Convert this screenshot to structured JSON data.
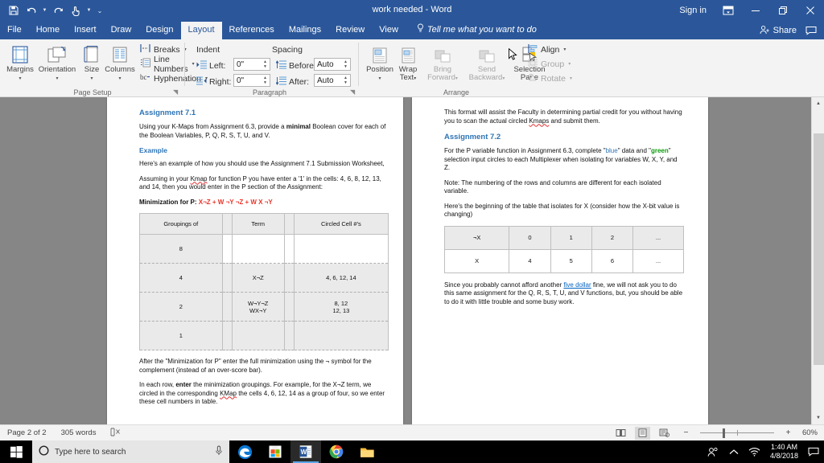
{
  "window": {
    "title": "work needed  -  Word",
    "sign_in": "Sign in",
    "ribbon_display_icon": "ribbon-display-options-icon",
    "minimize_icon": "minimize-icon",
    "restore_icon": "restore-icon",
    "close_icon": "close-icon",
    "quick_access": [
      {
        "name": "save-icon",
        "glyph": "὚B"
      },
      {
        "name": "undo-icon",
        "glyph": "↶"
      },
      {
        "name": "redo-icon",
        "glyph": "↻"
      },
      {
        "name": "touch-mode-icon",
        "glyph": "☝"
      },
      {
        "name": "customize-quick-access-toolbar-icon",
        "glyph": "☰"
      }
    ]
  },
  "tabs": [
    {
      "label": "File",
      "active": false
    },
    {
      "label": "Home",
      "active": false
    },
    {
      "label": "Insert",
      "active": false
    },
    {
      "label": "Draw",
      "active": false
    },
    {
      "label": "Design",
      "active": false
    },
    {
      "label": "Layout",
      "active": true
    },
    {
      "label": "References",
      "active": false
    },
    {
      "label": "Mailings",
      "active": false
    },
    {
      "label": "Review",
      "active": false
    },
    {
      "label": "View",
      "active": false
    }
  ],
  "tellme": {
    "label": "Tell me what you want to do",
    "icon": "lightbulb-icon"
  },
  "share": {
    "label": "Share",
    "icon": "share-person-icon",
    "comments_icon": "comments-icon"
  },
  "ribbon": {
    "groups": [
      {
        "name": "page-setup",
        "label": "Page Setup"
      },
      {
        "name": "paragraph",
        "label": "Paragraph"
      },
      {
        "name": "arrange",
        "label": "Arrange"
      }
    ],
    "page_setup": {
      "margins": "Margins",
      "orientation": "Orientation",
      "size": "Size",
      "columns": "Columns",
      "breaks": "Breaks",
      "line_numbers": "Line Numbers",
      "hyphenation": "Hyphenation"
    },
    "paragraph": {
      "indent_label": "Indent",
      "spacing_label": "Spacing",
      "left_label": "Left:",
      "right_label": "Right:",
      "before_label": "Before:",
      "after_label": "After:",
      "left_value": "0\"",
      "right_value": "0\"",
      "before_value": "Auto",
      "after_value": "Auto"
    },
    "arrange": {
      "position": "Position",
      "wrap_text": "Wrap\nText",
      "wrap_text_l1": "Wrap",
      "wrap_text_l2": "Text",
      "bring_forward_l1": "Bring",
      "bring_forward_l2": "Forward",
      "send_backward_l1": "Send",
      "send_backward_l2": "Backward",
      "selection_pane_l1": "Selection",
      "selection_pane_l2": "Pane",
      "align": "Align",
      "group": "Group",
      "rotate": "Rotate"
    }
  },
  "document": {
    "page1": {
      "heading": "Assignment 7.1",
      "para1_a": "Using your K-Maps from Assignment 6.3, provide a ",
      "para1_b": "minimal",
      "para1_c": " Boolean cover for each of the Boolean Variables, P, Q, R, S, T, U, and V.",
      "example_heading": "Example",
      "para2": "Here's an example of how you should use the Assignment 7.1 Submission Worksheet,",
      "para3_a": "Assuming in your ",
      "para3_kmap": "Kmap",
      "para3_b": " for function P you have enter a '1' in the cells: 4, 6, 8, 12, 13, and 14, then you would enter in the P section of the Assignment:",
      "min_label": "Minimization for P:",
      "min_value": "X¬Z + W ¬Y ¬Z + W X ¬Y",
      "table": {
        "headers": [
          "Groupings of",
          "Term",
          "Circled Cell #'s"
        ],
        "rows": [
          {
            "grouping": "8",
            "term": "",
            "cells": ""
          },
          {
            "grouping": "4",
            "term": "X¬Z",
            "cells": "4, 6, 12, 14"
          },
          {
            "grouping": "2",
            "term": "W¬Y¬Z\nWX¬Y",
            "term_l1": "W¬Y¬Z",
            "term_l2": "WX¬Y",
            "cells_l1": "8, 12",
            "cells_l2": "12, 13"
          },
          {
            "grouping": "1",
            "term": "",
            "cells": ""
          }
        ]
      },
      "para4": "After the \"Minimization for P\" enter the full minimization using the ¬ symbol for the complement (instead of an over-score bar).",
      "para5_a": "In each row, ",
      "para5_b": "enter",
      "para5_c": " the minimization groupings. For example, for the X¬Z term, we circled in the corresponding ",
      "para5_kmap": "KMap",
      "para5_d": " the cells 4, 6, 12, 14 as a group of four, so we enter these cell numbers in table."
    },
    "page2": {
      "para1_a": "This format will assist the Faculty in determining partial credit for you without having you to scan the actual circled ",
      "para1_kmap": "Kmaps",
      "para1_b": " and submit them.",
      "heading": "Assignment 7.2",
      "para2_a": "For the P variable function in Assignment 6.3, complete \"",
      "para2_blue": "blue",
      "para2_b": "\" data and \"",
      "para2_green": "green",
      "para2_c": "\" selection input circles to each Multiplexer when isolating for variables W, X, Y, and Z.",
      "para3": "Note: The numbering of the rows and columns are different for each isolated variable.",
      "para4": "Here's the beginning of the table that isolates for X (consider how the X-bit value is changing)",
      "table": {
        "row1": [
          "¬X",
          "0",
          "1",
          "2",
          "..."
        ],
        "row2": [
          "X",
          "4",
          "5",
          "6",
          "..."
        ]
      },
      "para5_a": "Since you probably cannot afford another ",
      "para5_link": "five dollar",
      "para5_b": " fine, we will not ask you to do this same assignment for the Q, R, S, T, U, and V functions, but, you should be able to do it with little trouble and some busy work."
    }
  },
  "statusbar": {
    "page": "Page 2 of 2",
    "words": "305 words",
    "proofing_icon": "proofing-errors-icon",
    "read_mode_icon": "read-mode-icon",
    "print_layout_icon": "print-layout-icon",
    "web_layout_icon": "web-layout-icon",
    "zoom_out_icon": "zoom-out-icon",
    "zoom_in_icon": "zoom-in-icon",
    "zoom_level": "60%"
  },
  "taskbar": {
    "start_icon": "windows-start-icon",
    "search_icon": "search-circle-icon",
    "search_placeholder": "Type here to search",
    "mic_icon": "microphone-icon",
    "apps": [
      {
        "name": "edge-icon",
        "active": false
      },
      {
        "name": "microsoft-store-icon",
        "active": false
      },
      {
        "name": "word-icon",
        "active": true
      },
      {
        "name": "chrome-icon",
        "active": false
      },
      {
        "name": "file-explorer-icon",
        "active": false
      }
    ],
    "tray": {
      "people_icon": "people-icon",
      "chevron_up_icon": "show-hidden-icons-icon",
      "network_icon": "wifi-icon",
      "time": "1:40 AM",
      "date": "4/8/2018",
      "action_center_icon": "action-center-icon"
    }
  },
  "colors": {
    "word_blue": "#2b579a",
    "ribbon_bg": "#f3f3f3",
    "heading_blue": "#2e74b5",
    "accent_red": "#e8342a",
    "accent_green": "#0a9c0a",
    "doc_bg": "#868686"
  }
}
